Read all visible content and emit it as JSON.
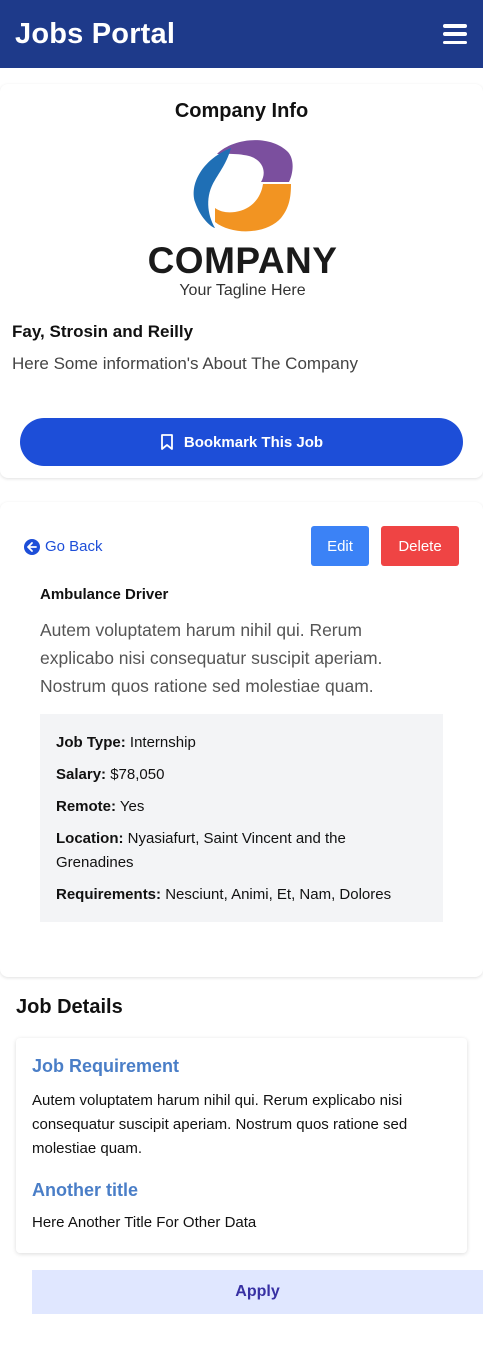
{
  "header": {
    "brand": "Jobs Portal",
    "menu_icon": "hamburger-menu-icon"
  },
  "company": {
    "heading": "Company Info",
    "logo": {
      "wordmark": "COMPANY",
      "tagline": "Your Tagline Here",
      "colors": {
        "purple": "#7b4f9e",
        "blue": "#1f6fb5",
        "orange": "#f29422"
      }
    },
    "name": "Fay, Strosin and Reilly",
    "description": "Here Some information's About The Company",
    "bookmark_label": "Bookmark This Job",
    "bookmark_icon": "bookmark-icon"
  },
  "job": {
    "go_back_label": "Go Back",
    "go_back_icon": "arrow-left-circle-icon",
    "edit_label": "Edit",
    "delete_label": "Delete",
    "title": "Ambulance Driver",
    "description": "Autem voluptatem harum nihil qui. Rerum explicabo nisi consequatur suscipit aperiam. Nostrum quos ratione sed molestiae quam.",
    "meta": {
      "job_type_label": "Job Type:",
      "job_type_value": "Internship",
      "salary_label": "Salary:",
      "salary_value": "$78,050",
      "remote_label": "Remote:",
      "remote_value": "Yes",
      "location_label": "Location:",
      "location_value": "Nyasiafurt, Saint Vincent and the Grenadines",
      "requirements_label": "Requirements:",
      "requirements_value": "Nesciunt, Animi, Et, Nam, Dolores"
    }
  },
  "details": {
    "heading": "Job Details",
    "requirement_title": "Job Requirement",
    "requirement_text": "Autem voluptatem harum nihil qui. Rerum explicabo nisi consequatur suscipit aperiam. Nostrum quos ratione sed molestiae quam.",
    "other_title": "Another title",
    "other_text": "Here Another Title For Other Data",
    "apply_label": "Apply"
  },
  "colors": {
    "header_bg": "#1e3a8a",
    "primary": "#1d4ed8",
    "edit": "#3b82f6",
    "delete": "#ef4444",
    "apply_bg": "#e0e7ff",
    "apply_text": "#3730a3",
    "section_title": "#4a7ec7"
  }
}
